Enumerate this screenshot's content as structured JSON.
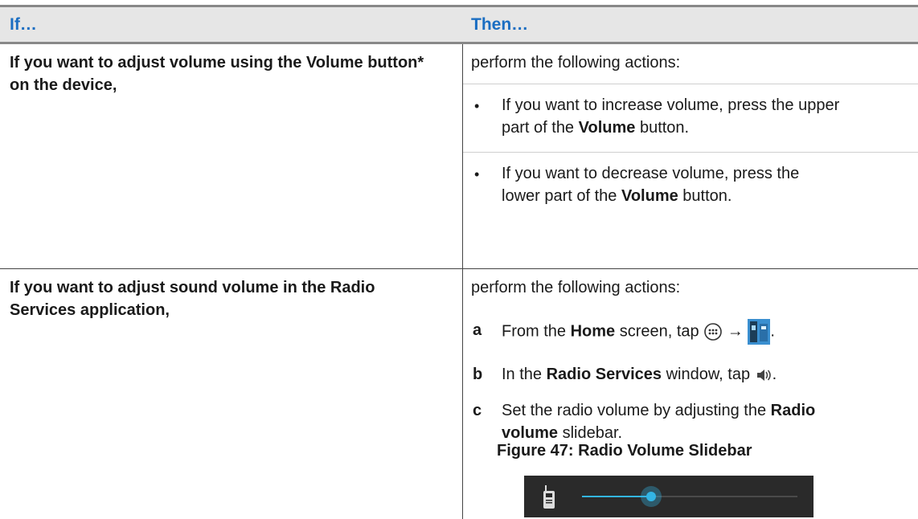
{
  "header": {
    "if_label": "If…",
    "then_label": "Then…"
  },
  "row1": {
    "condition": "If you want to adjust volume using the Volume button* on the device,",
    "intro": "perform the following actions:",
    "bullets": [
      {
        "pre": "If you want to increase volume, press the upper part of the ",
        "bold": "Volume",
        "post": " button."
      },
      {
        "pre": "If you want to decrease volume, press the lower part of the ",
        "bold": "Volume",
        "post": " button."
      }
    ]
  },
  "row2": {
    "condition": "If you want to adjust sound volume in the Radio Services application,",
    "intro": "perform the following actions:",
    "steps": [
      {
        "letter": "a",
        "pre": "From the ",
        "bold": "Home",
        "post": " screen, tap",
        "arrow": "→"
      },
      {
        "letter": "b",
        "pre": "In the ",
        "bold": "Radio Services",
        "post": " window, tap"
      },
      {
        "letter": "c",
        "pre": "Set the radio volume by adjusting the ",
        "bold": "Radio volume",
        "post": " slidebar."
      }
    ],
    "figure_title": "Figure 47: Radio Volume Slidebar",
    "slider_level": 0.32
  },
  "colors": {
    "header_text": "#1b6ec2",
    "header_bg": "#e6e6e6",
    "slider_accent": "#33b5e5"
  },
  "icons": [
    "apps-grid-icon",
    "radio-services-app-icon",
    "speaker-volume-icon",
    "walkie-talkie-icon"
  ]
}
